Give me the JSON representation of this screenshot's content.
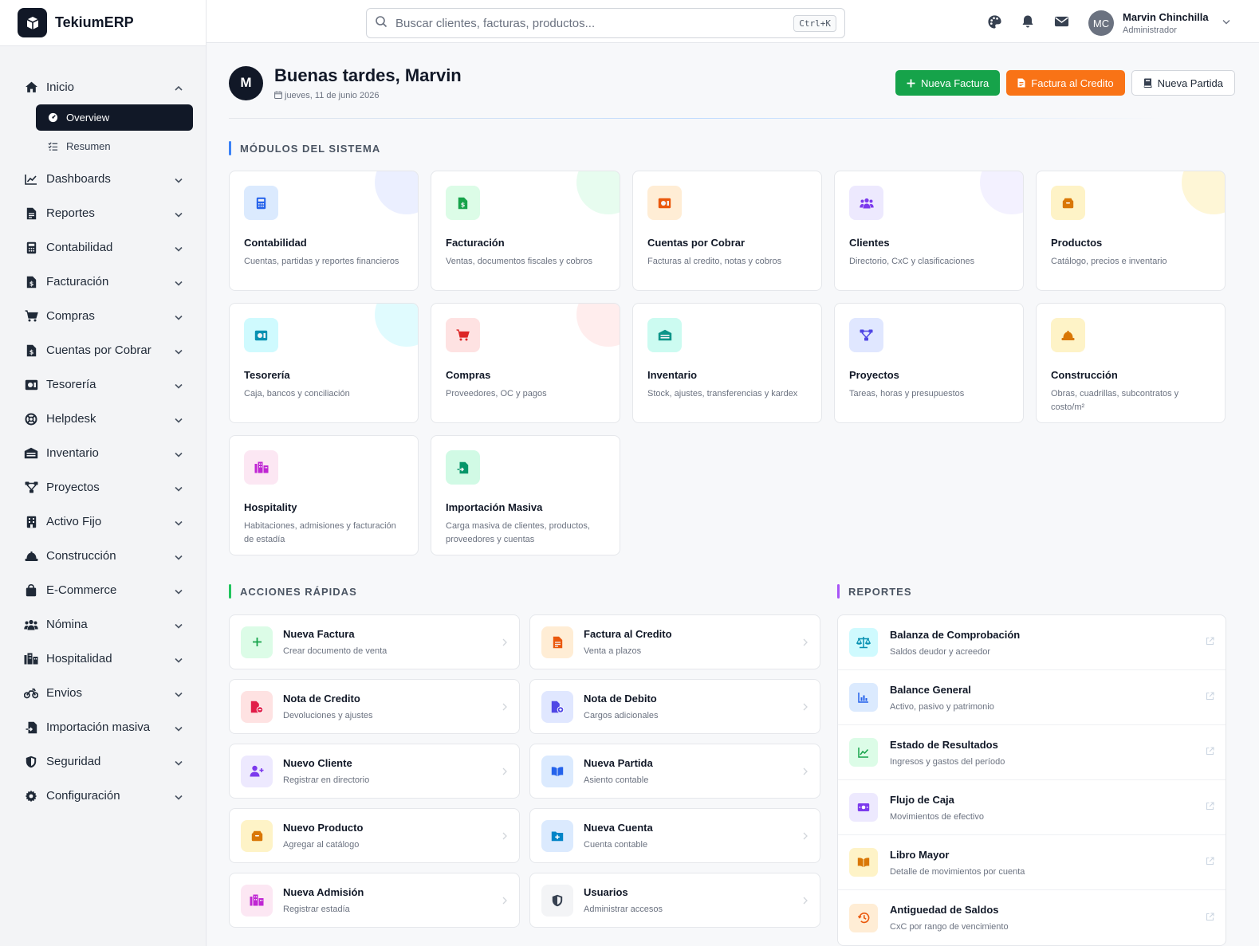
{
  "app": {
    "name": "TekiumERP"
  },
  "search": {
    "placeholder": "Buscar clientes, facturas, productos...",
    "shortcut": "Ctrl+K"
  },
  "user": {
    "initials": "MC",
    "name": "Marvin Chinchilla",
    "role": "Administrador"
  },
  "sidebar": {
    "inicio": {
      "label": "Inicio",
      "sub": [
        {
          "label": "Overview"
        },
        {
          "label": "Resumen"
        }
      ]
    },
    "items": [
      {
        "label": "Dashboards"
      },
      {
        "label": "Reportes"
      },
      {
        "label": "Contabilidad"
      },
      {
        "label": "Facturación"
      },
      {
        "label": "Compras"
      },
      {
        "label": "Cuentas por Cobrar"
      },
      {
        "label": "Tesorería"
      },
      {
        "label": "Helpdesk"
      },
      {
        "label": "Inventario"
      },
      {
        "label": "Proyectos"
      },
      {
        "label": "Activo Fijo"
      },
      {
        "label": "Construcción"
      },
      {
        "label": "E-Commerce"
      },
      {
        "label": "Nómina"
      },
      {
        "label": "Hospitalidad"
      },
      {
        "label": "Envios"
      },
      {
        "label": "Importación masiva"
      },
      {
        "label": "Seguridad"
      },
      {
        "label": "Configuración"
      }
    ]
  },
  "greeting": {
    "initial": "M",
    "title": "Buenas tardes, Marvin",
    "date": "jueves, 11 de junio 2026"
  },
  "actions": {
    "new_invoice": "Nueva Factura",
    "credit_invoice": "Factura al Credito",
    "new_entry": "Nueva Partida"
  },
  "modules": {
    "title": "MÓDULOS DEL SISTEMA",
    "items": [
      {
        "title": "Contabilidad",
        "desc": "Cuentas, partidas y reportes financieros"
      },
      {
        "title": "Facturación",
        "desc": "Ventas, documentos fiscales y cobros"
      },
      {
        "title": "Cuentas por Cobrar",
        "desc": "Facturas al credito, notas y cobros"
      },
      {
        "title": "Clientes",
        "desc": "Directorio, CxC y clasificaciones"
      },
      {
        "title": "Productos",
        "desc": "Catálogo, precios e inventario"
      },
      {
        "title": "Tesorería",
        "desc": "Caja, bancos y conciliación"
      },
      {
        "title": "Compras",
        "desc": "Proveedores, OC y pagos"
      },
      {
        "title": "Inventario",
        "desc": "Stock, ajustes, transferencias y kardex"
      },
      {
        "title": "Proyectos",
        "desc": "Tareas, horas y presupuestos"
      },
      {
        "title": "Construcción",
        "desc": "Obras, cuadrillas, subcontratos y costo/m²"
      },
      {
        "title": "Hospitality",
        "desc": "Habitaciones, admisiones y facturación de estadía"
      },
      {
        "title": "Importación Masiva",
        "desc": "Carga masiva de clientes, productos, proveedores y cuentas"
      }
    ]
  },
  "quick": {
    "title": "ACCIONES RÁPIDAS",
    "items": [
      {
        "title": "Nueva Factura",
        "desc": "Crear documento de venta"
      },
      {
        "title": "Factura al Credito",
        "desc": "Venta a plazos"
      },
      {
        "title": "Nota de Credito",
        "desc": "Devoluciones y ajustes"
      },
      {
        "title": "Nota de Debito",
        "desc": "Cargos adicionales"
      },
      {
        "title": "Nuevo Cliente",
        "desc": "Registrar en directorio"
      },
      {
        "title": "Nueva Partida",
        "desc": "Asiento contable"
      },
      {
        "title": "Nuevo Producto",
        "desc": "Agregar al catálogo"
      },
      {
        "title": "Nueva Cuenta",
        "desc": "Cuenta contable"
      },
      {
        "title": "Nueva Admisión",
        "desc": "Registrar estadía"
      },
      {
        "title": "Usuarios",
        "desc": "Administrar accesos"
      }
    ]
  },
  "reports": {
    "title": "REPORTES",
    "items": [
      {
        "title": "Balanza de Comprobación",
        "desc": "Saldos deudor y acreedor"
      },
      {
        "title": "Balance General",
        "desc": "Activo, pasivo y patrimonio"
      },
      {
        "title": "Estado de Resultados",
        "desc": "Ingresos y gastos del período"
      },
      {
        "title": "Flujo de Caja",
        "desc": "Movimientos de efectivo"
      },
      {
        "title": "Libro Mayor",
        "desc": "Detalle de movimientos por cuenta"
      },
      {
        "title": "Antiguedad de Saldos",
        "desc": "CxC por rango de vencimiento"
      }
    ]
  },
  "colors": {
    "primary": "#111827",
    "green": "#16a34a",
    "orange": "#f97316",
    "blue_accent": "#3b82f6",
    "purple_accent": "#a855f7"
  }
}
